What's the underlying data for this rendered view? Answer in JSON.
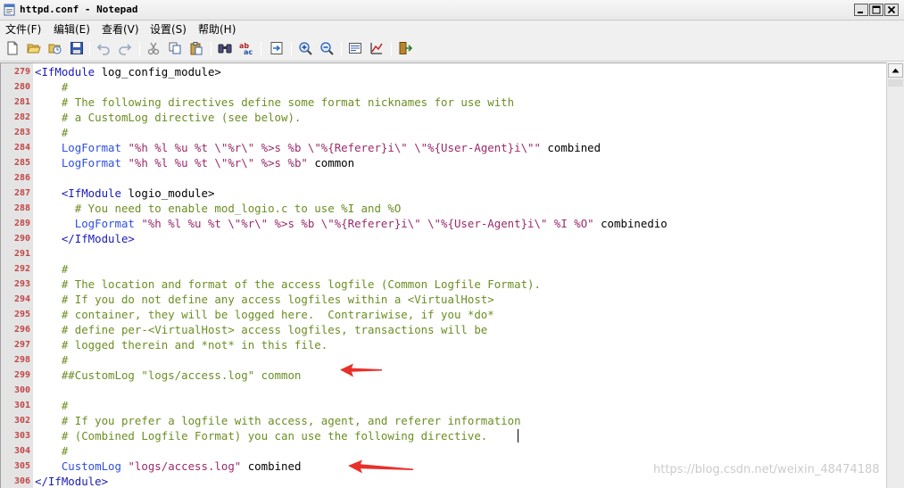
{
  "window": {
    "title": "httpd.conf - Notepad",
    "buttons": {
      "minimize": "minimize",
      "maximize": "maximize",
      "close": "close"
    }
  },
  "menu": [
    "文件(F)",
    "编辑(E)",
    "查看(V)",
    "设置(S)",
    "帮助(H)"
  ],
  "toolbar": {
    "icons": [
      "new-file-icon",
      "open-file-icon",
      "reload-icon",
      "save-icon",
      "undo-icon",
      "redo-icon",
      "cut-icon",
      "copy-icon",
      "paste-icon",
      "find-icon",
      "replace-icon",
      "goto-icon",
      "zoom-in-icon",
      "zoom-out-icon",
      "word-wrap-icon",
      "scheme-icon",
      "exit-icon"
    ]
  },
  "editor": {
    "lines": [
      {
        "num": "279",
        "segments": [
          [
            "tag",
            "<IfModule"
          ],
          [
            "plain",
            " log_config_module>"
          ]
        ]
      },
      {
        "num": "280",
        "segments": [
          [
            "comment",
            "    #"
          ]
        ]
      },
      {
        "num": "281",
        "segments": [
          [
            "comment",
            "    # The following directives define some format nicknames for use with"
          ]
        ]
      },
      {
        "num": "282",
        "segments": [
          [
            "comment",
            "    # a CustomLog directive (see below)."
          ]
        ]
      },
      {
        "num": "283",
        "segments": [
          [
            "comment",
            "    #"
          ]
        ]
      },
      {
        "num": "284",
        "segments": [
          [
            "dir",
            "    LogFormat"
          ],
          [
            "str",
            " \"%h %l %u %t \\\"%r\\\" %>s %b \\\"%{Referer}i\\\" \\\"%{User-Agent}i\\\"\""
          ],
          [
            "plain",
            " combined"
          ]
        ]
      },
      {
        "num": "285",
        "segments": [
          [
            "dir",
            "    LogFormat"
          ],
          [
            "str",
            " \"%h %l %u %t \\\"%r\\\" %>s %b\""
          ],
          [
            "plain",
            " common"
          ]
        ]
      },
      {
        "num": "286",
        "segments": []
      },
      {
        "num": "287",
        "segments": [
          [
            "tag",
            "    <IfModule"
          ],
          [
            "plain",
            " logio_module>"
          ]
        ]
      },
      {
        "num": "288",
        "segments": [
          [
            "comment",
            "      # You need to enable mod_logio.c to use %I and %O"
          ]
        ]
      },
      {
        "num": "289",
        "segments": [
          [
            "dir",
            "      LogFormat"
          ],
          [
            "str",
            " \"%h %l %u %t \\\"%r\\\" %>s %b \\\"%{Referer}i\\\" \\\"%{User-Agent}i\\\" %I %O\""
          ],
          [
            "plain",
            " combinedio"
          ]
        ]
      },
      {
        "num": "290",
        "segments": [
          [
            "tag",
            "    </IfModule>"
          ]
        ]
      },
      {
        "num": "291",
        "segments": []
      },
      {
        "num": "292",
        "segments": [
          [
            "comment",
            "    #"
          ]
        ]
      },
      {
        "num": "293",
        "segments": [
          [
            "comment",
            "    # The location and format of the access logfile (Common Logfile Format)."
          ]
        ]
      },
      {
        "num": "294",
        "segments": [
          [
            "comment",
            "    # If you do not define any access logfiles within a <VirtualHost>"
          ]
        ]
      },
      {
        "num": "295",
        "segments": [
          [
            "comment",
            "    # container, they will be logged here.  Contrariwise, if you *do*"
          ]
        ]
      },
      {
        "num": "296",
        "segments": [
          [
            "comment",
            "    # define per-<VirtualHost> access logfiles, transactions will be"
          ]
        ]
      },
      {
        "num": "297",
        "segments": [
          [
            "comment",
            "    # logged therein and *not* in this file."
          ]
        ]
      },
      {
        "num": "298",
        "segments": [
          [
            "comment",
            "    #"
          ]
        ]
      },
      {
        "num": "299",
        "segments": [
          [
            "comment",
            "    ##CustomLog \"logs/access.log\" common"
          ]
        ]
      },
      {
        "num": "300",
        "segments": []
      },
      {
        "num": "301",
        "segments": [
          [
            "comment",
            "    #"
          ]
        ]
      },
      {
        "num": "302",
        "segments": [
          [
            "comment",
            "    # If you prefer a logfile with access, agent, and referer information"
          ]
        ]
      },
      {
        "num": "303",
        "segments": [
          [
            "comment",
            "    # (Combined Logfile Format) you can use the following directive."
          ]
        ]
      },
      {
        "num": "304",
        "segments": [
          [
            "comment",
            "    #"
          ]
        ]
      },
      {
        "num": "305",
        "segments": [
          [
            "dir",
            "    CustomLog"
          ],
          [
            "str",
            " \"logs/access.log\""
          ],
          [
            "plain",
            " combined"
          ]
        ]
      },
      {
        "num": "306",
        "segments": [
          [
            "tag",
            "</IfModule>"
          ]
        ]
      }
    ]
  },
  "annotations": {
    "arrow_color": "#e8302a",
    "arrow_lines": [
      "299",
      "305"
    ]
  },
  "watermark": "https://blog.csdn.net/weixin_48474188",
  "colors": {
    "line_numbers": "#c24545",
    "gutter": "#e4e4e4",
    "comment": "#6b8e23",
    "tag": "#1a1ab8",
    "directive": "#2f4fe0",
    "string": "#9b2a6b"
  }
}
